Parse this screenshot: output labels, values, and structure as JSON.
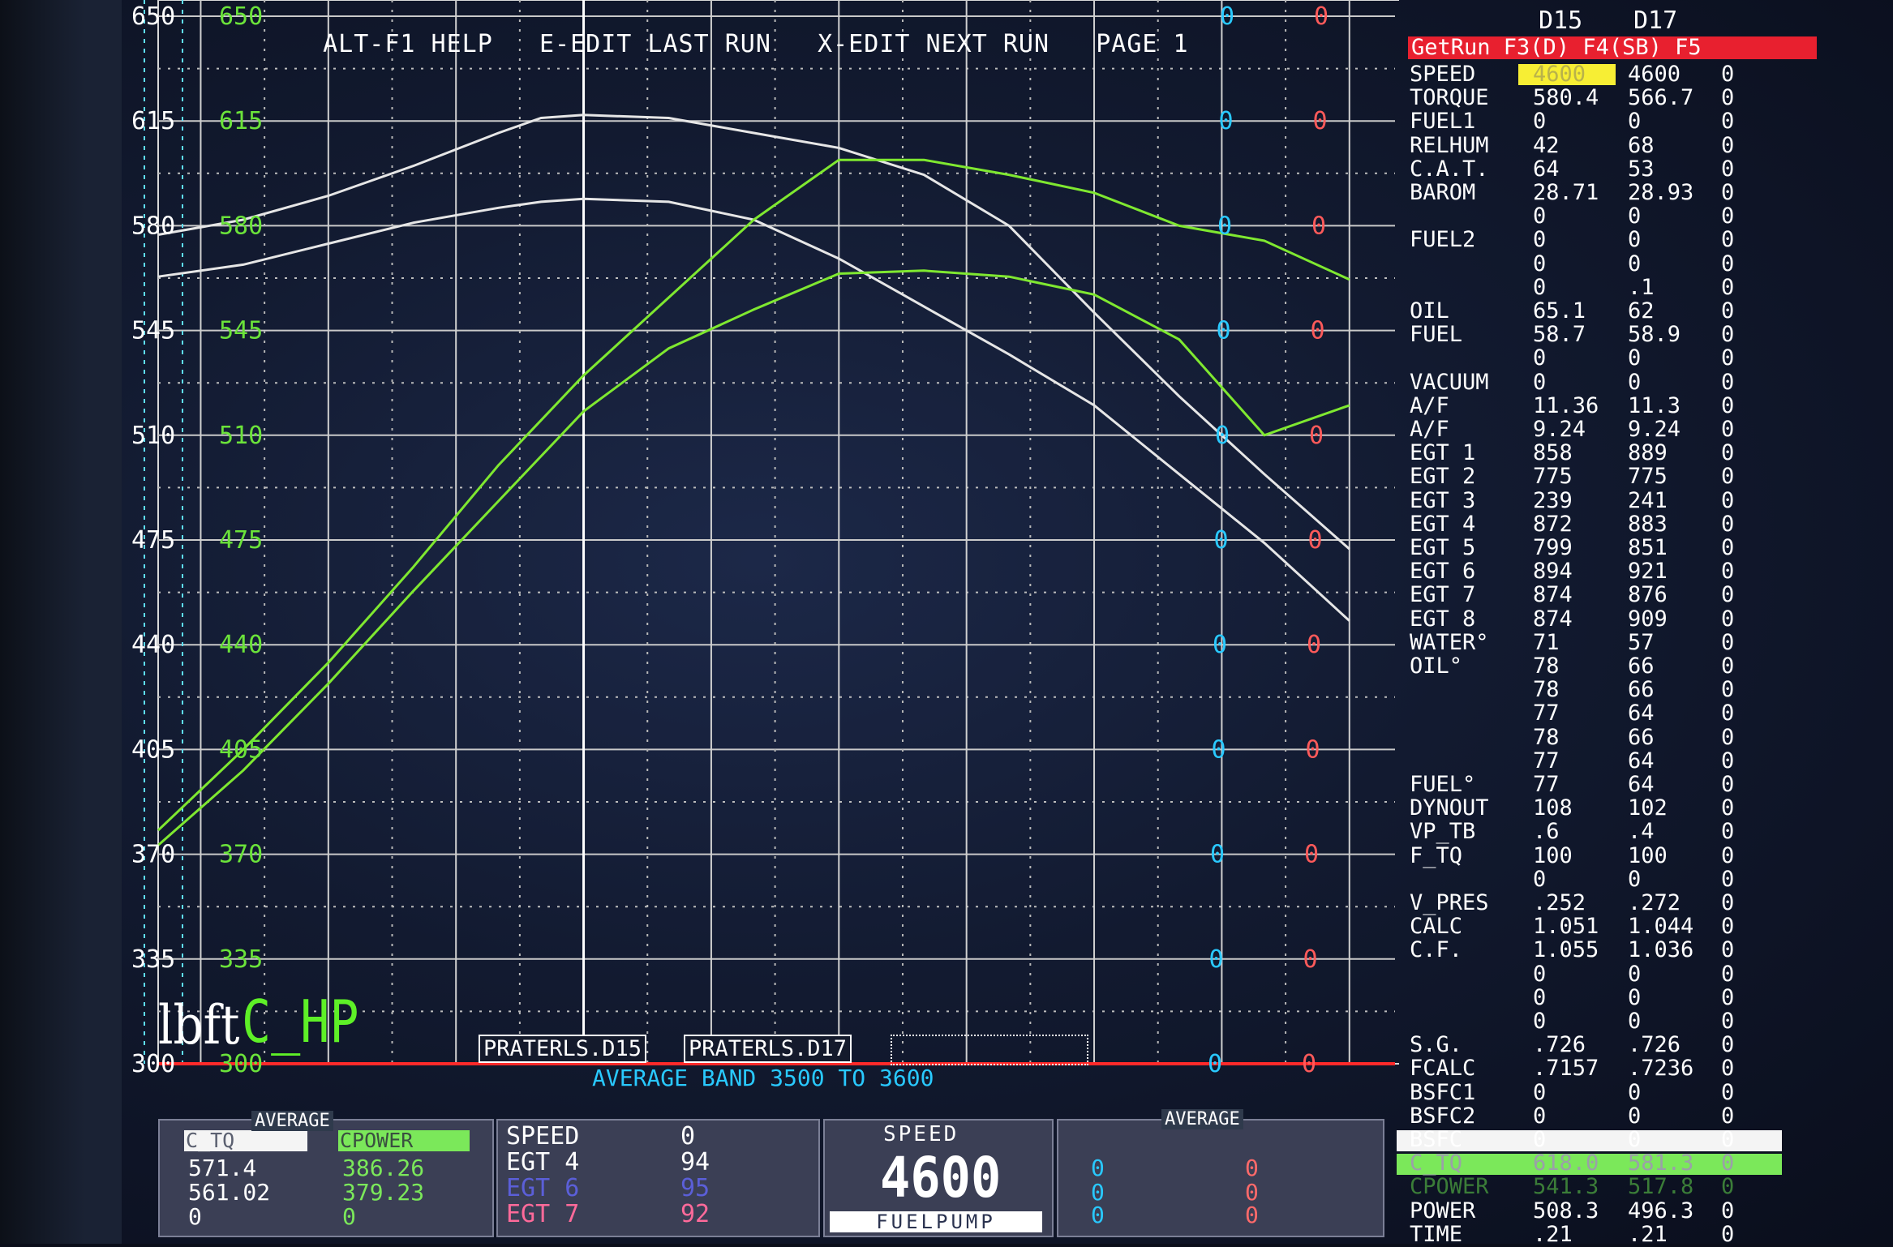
{
  "header": {
    "top_left_scale": "650",
    "top_left_scale_green": "650",
    "help": "ALT-F1 HELP",
    "edit_last": "E-EDIT LAST RUN",
    "edit_next": "X-EDIT NEXT RUN",
    "page": "PAGE 1",
    "marker_cyan": "0",
    "marker_red": "0"
  },
  "y_scale": {
    "white_labels": [
      "650",
      "615",
      "580",
      "545",
      "510",
      "475",
      "440",
      "405",
      "370",
      "335",
      "300"
    ],
    "green_labels": [
      "650",
      "615",
      "580",
      "545",
      "510",
      "475",
      "440",
      "405",
      "370",
      "335",
      "300"
    ],
    "right_cyan": [
      "0",
      "0",
      "0",
      "0",
      "0",
      "0",
      "0",
      "0",
      "0",
      "0",
      "0"
    ],
    "right_red": [
      "0",
      "0",
      "0",
      "0",
      "0",
      "0",
      "0",
      "0",
      "0",
      "0",
      "0"
    ]
  },
  "x_ticks": [
    "3800",
    "4100",
    "4400",
    "4700",
    "5000",
    "5300",
    "5600",
    "5900",
    "6200",
    "6500"
  ],
  "legend": {
    "torque_tag": "lbft",
    "power_tag": "C_HP"
  },
  "run_files": [
    "PRATERLS.D15",
    "PRATERLS.D17"
  ],
  "average_band": "AVERAGE BAND 3500 TO 3600",
  "chart_data": {
    "type": "line",
    "xlabel": "",
    "ylabel": "",
    "xlim": [
      3700,
      6550
    ],
    "ylim": [
      300,
      650
    ],
    "series": [
      {
        "name": "C_TQ D15",
        "unit": "lbft",
        "color": "#e6e6e6",
        "x": [
          3700,
          3900,
          4100,
          4300,
          4500,
          4600,
          4700,
          4900,
          5100,
          5300,
          5500,
          5700,
          5900,
          6100,
          6300,
          6500
        ],
        "y": [
          577,
          582,
          590,
          600,
          611,
          616,
          617,
          616,
          611,
          606,
          597,
          580,
          551,
          523,
          497,
          472
        ]
      },
      {
        "name": "C_TQ D17",
        "unit": "lbft",
        "color": "#e6e6e6",
        "x": [
          3700,
          3900,
          4100,
          4300,
          4500,
          4600,
          4700,
          4900,
          5100,
          5300,
          5500,
          5700,
          5900,
          6100,
          6300,
          6500
        ],
        "y": [
          563,
          567,
          574,
          581,
          586,
          588,
          589,
          588,
          582,
          569,
          553,
          537,
          520,
          497,
          474,
          448
        ]
      },
      {
        "name": "CPOWER D15",
        "unit": "C_HP",
        "color": "#7fe830",
        "x": [
          3700,
          3900,
          4100,
          4300,
          4500,
          4700,
          4900,
          5100,
          5300,
          5500,
          5700,
          5900,
          6100,
          6300,
          6500
        ],
        "y": [
          378,
          405,
          434,
          466,
          500,
          530,
          556,
          582,
          602,
          602,
          597,
          591,
          580,
          575,
          562
        ]
      },
      {
        "name": "CPOWER D17",
        "unit": "C_HP",
        "color": "#7fe830",
        "x": [
          3700,
          3900,
          4100,
          4300,
          4500,
          4700,
          4900,
          5100,
          5300,
          5500,
          5700,
          5900,
          6100,
          6300,
          6500
        ],
        "y": [
          373,
          398,
          427,
          458,
          488,
          518,
          539,
          552,
          564,
          565,
          563,
          557,
          542,
          510,
          520
        ]
      }
    ]
  },
  "right_panel": {
    "col_headers": [
      "D15",
      "D17"
    ],
    "menu": "GetRun F3(D) F4(SB) F5",
    "rows": [
      {
        "label": "SPEED",
        "v1": "4600",
        "v2": "4600",
        "v3": "0"
      },
      {
        "label": "TORQUE",
        "v1": "580.4",
        "v2": "566.7",
        "v3": "0"
      },
      {
        "label": "FUEL1",
        "v1": "0",
        "v2": "0",
        "v3": "0"
      },
      {
        "label": "RELHUM",
        "v1": "42",
        "v2": "68",
        "v3": "0"
      },
      {
        "label": "C.A.T.",
        "v1": "64",
        "v2": "53",
        "v3": "0"
      },
      {
        "label": "BAROM",
        "v1": "28.71",
        "v2": "28.93",
        "v3": "0"
      },
      {
        "label": "",
        "v1": "0",
        "v2": "0",
        "v3": "0"
      },
      {
        "label": "FUEL2",
        "v1": "0",
        "v2": "0",
        "v3": "0"
      },
      {
        "label": "",
        "v1": "0",
        "v2": "0",
        "v3": "0"
      },
      {
        "label": "",
        "v1": "0",
        "v2": ".1",
        "v3": "0"
      },
      {
        "label": "OIL",
        "v1": "65.1",
        "v2": "62",
        "v3": "0"
      },
      {
        "label": "FUEL",
        "v1": "58.7",
        "v2": "58.9",
        "v3": "0"
      },
      {
        "label": "",
        "v1": "0",
        "v2": "0",
        "v3": "0"
      },
      {
        "label": "VACUUM",
        "v1": "0",
        "v2": "0",
        "v3": "0"
      },
      {
        "label": "A/F",
        "v1": "11.36",
        "v2": "11.3",
        "v3": "0"
      },
      {
        "label": "A/F",
        "v1": "9.24",
        "v2": "9.24",
        "v3": "0"
      },
      {
        "label": "EGT 1",
        "v1": "858",
        "v2": "889",
        "v3": "0"
      },
      {
        "label": "EGT 2",
        "v1": "775",
        "v2": "775",
        "v3": "0"
      },
      {
        "label": "EGT 3",
        "v1": "239",
        "v2": "241",
        "v3": "0"
      },
      {
        "label": "EGT 4",
        "v1": "872",
        "v2": "883",
        "v3": "0"
      },
      {
        "label": "EGT 5",
        "v1": "799",
        "v2": "851",
        "v3": "0"
      },
      {
        "label": "EGT 6",
        "v1": "894",
        "v2": "921",
        "v3": "0"
      },
      {
        "label": "EGT 7",
        "v1": "874",
        "v2": "876",
        "v3": "0"
      },
      {
        "label": "EGT 8",
        "v1": "874",
        "v2": "909",
        "v3": "0"
      },
      {
        "label": "WATER°",
        "v1": "71",
        "v2": "57",
        "v3": "0"
      },
      {
        "label": "OIL°",
        "v1": "78",
        "v2": "66",
        "v3": "0"
      },
      {
        "label": "",
        "v1": "78",
        "v2": "66",
        "v3": "0"
      },
      {
        "label": "",
        "v1": "77",
        "v2": "64",
        "v3": "0"
      },
      {
        "label": "",
        "v1": "78",
        "v2": "66",
        "v3": "0"
      },
      {
        "label": "",
        "v1": "77",
        "v2": "64",
        "v3": "0"
      },
      {
        "label": "FUEL°",
        "v1": "77",
        "v2": "64",
        "v3": "0"
      },
      {
        "label": "DYNOUT",
        "v1": "108",
        "v2": "102",
        "v3": "0"
      },
      {
        "label": "VP_TB",
        "v1": ".6",
        "v2": ".4",
        "v3": "0"
      },
      {
        "label": "F_TQ",
        "v1": "100",
        "v2": "100",
        "v3": "0"
      },
      {
        "label": "",
        "v1": "0",
        "v2": "0",
        "v3": "0"
      },
      {
        "label": "V_PRES",
        "v1": ".252",
        "v2": ".272",
        "v3": "0"
      },
      {
        "label": "CALC",
        "v1": "1.051",
        "v2": "1.044",
        "v3": "0"
      },
      {
        "label": "C.F.",
        "v1": "1.055",
        "v2": "1.036",
        "v3": "0"
      },
      {
        "label": "",
        "v1": "0",
        "v2": "0",
        "v3": "0"
      },
      {
        "label": "",
        "v1": "0",
        "v2": "0",
        "v3": "0"
      },
      {
        "label": "",
        "v1": "0",
        "v2": "0",
        "v3": "0"
      },
      {
        "label": "S.G.",
        "v1": ".726",
        "v2": ".726",
        "v3": "0"
      },
      {
        "label": "FCALC",
        "v1": ".7157",
        "v2": ".7236",
        "v3": "0"
      },
      {
        "label": "BSFC1",
        "v1": "0",
        "v2": "0",
        "v3": "0"
      },
      {
        "label": "BSFC2",
        "v1": "0",
        "v2": "0",
        "v3": "0"
      },
      {
        "label": "BSFC",
        "v1": "0",
        "v2": "0",
        "v3": "0"
      },
      {
        "label": "C_TQ",
        "v1": "618.0",
        "v2": "581.3",
        "v3": "0"
      },
      {
        "label": "CPOWER",
        "v1": "541.3",
        "v2": "517.8",
        "v3": "0"
      },
      {
        "label": "POWER",
        "v1": "508.3",
        "v2": "496.3",
        "v3": "0"
      },
      {
        "label": "TIME",
        "v1": ".21",
        "v2": ".21",
        "v3": "0"
      }
    ]
  },
  "bottom": {
    "average_tag": "AVERAGE",
    "avg_headers": [
      "C_TQ",
      "CPOWER"
    ],
    "avg_rows": [
      [
        "571.4",
        "386.26"
      ],
      [
        "561.02",
        "379.23"
      ],
      [
        "0",
        "0"
      ]
    ],
    "live": [
      {
        "label": "SPEED",
        "value": "0"
      },
      {
        "label": "EGT 4",
        "value": "94"
      },
      {
        "label": "EGT 6",
        "value": "95"
      },
      {
        "label": "EGT 7",
        "value": "92"
      }
    ],
    "speed_title": "SPEED",
    "speed_value": "4600",
    "fuelpump": "FUELPUMP",
    "average_tag2": "AVERAGE",
    "right_zeros": [
      [
        "0",
        "0"
      ],
      [
        "0",
        "0"
      ],
      [
        "0",
        "0"
      ]
    ]
  }
}
